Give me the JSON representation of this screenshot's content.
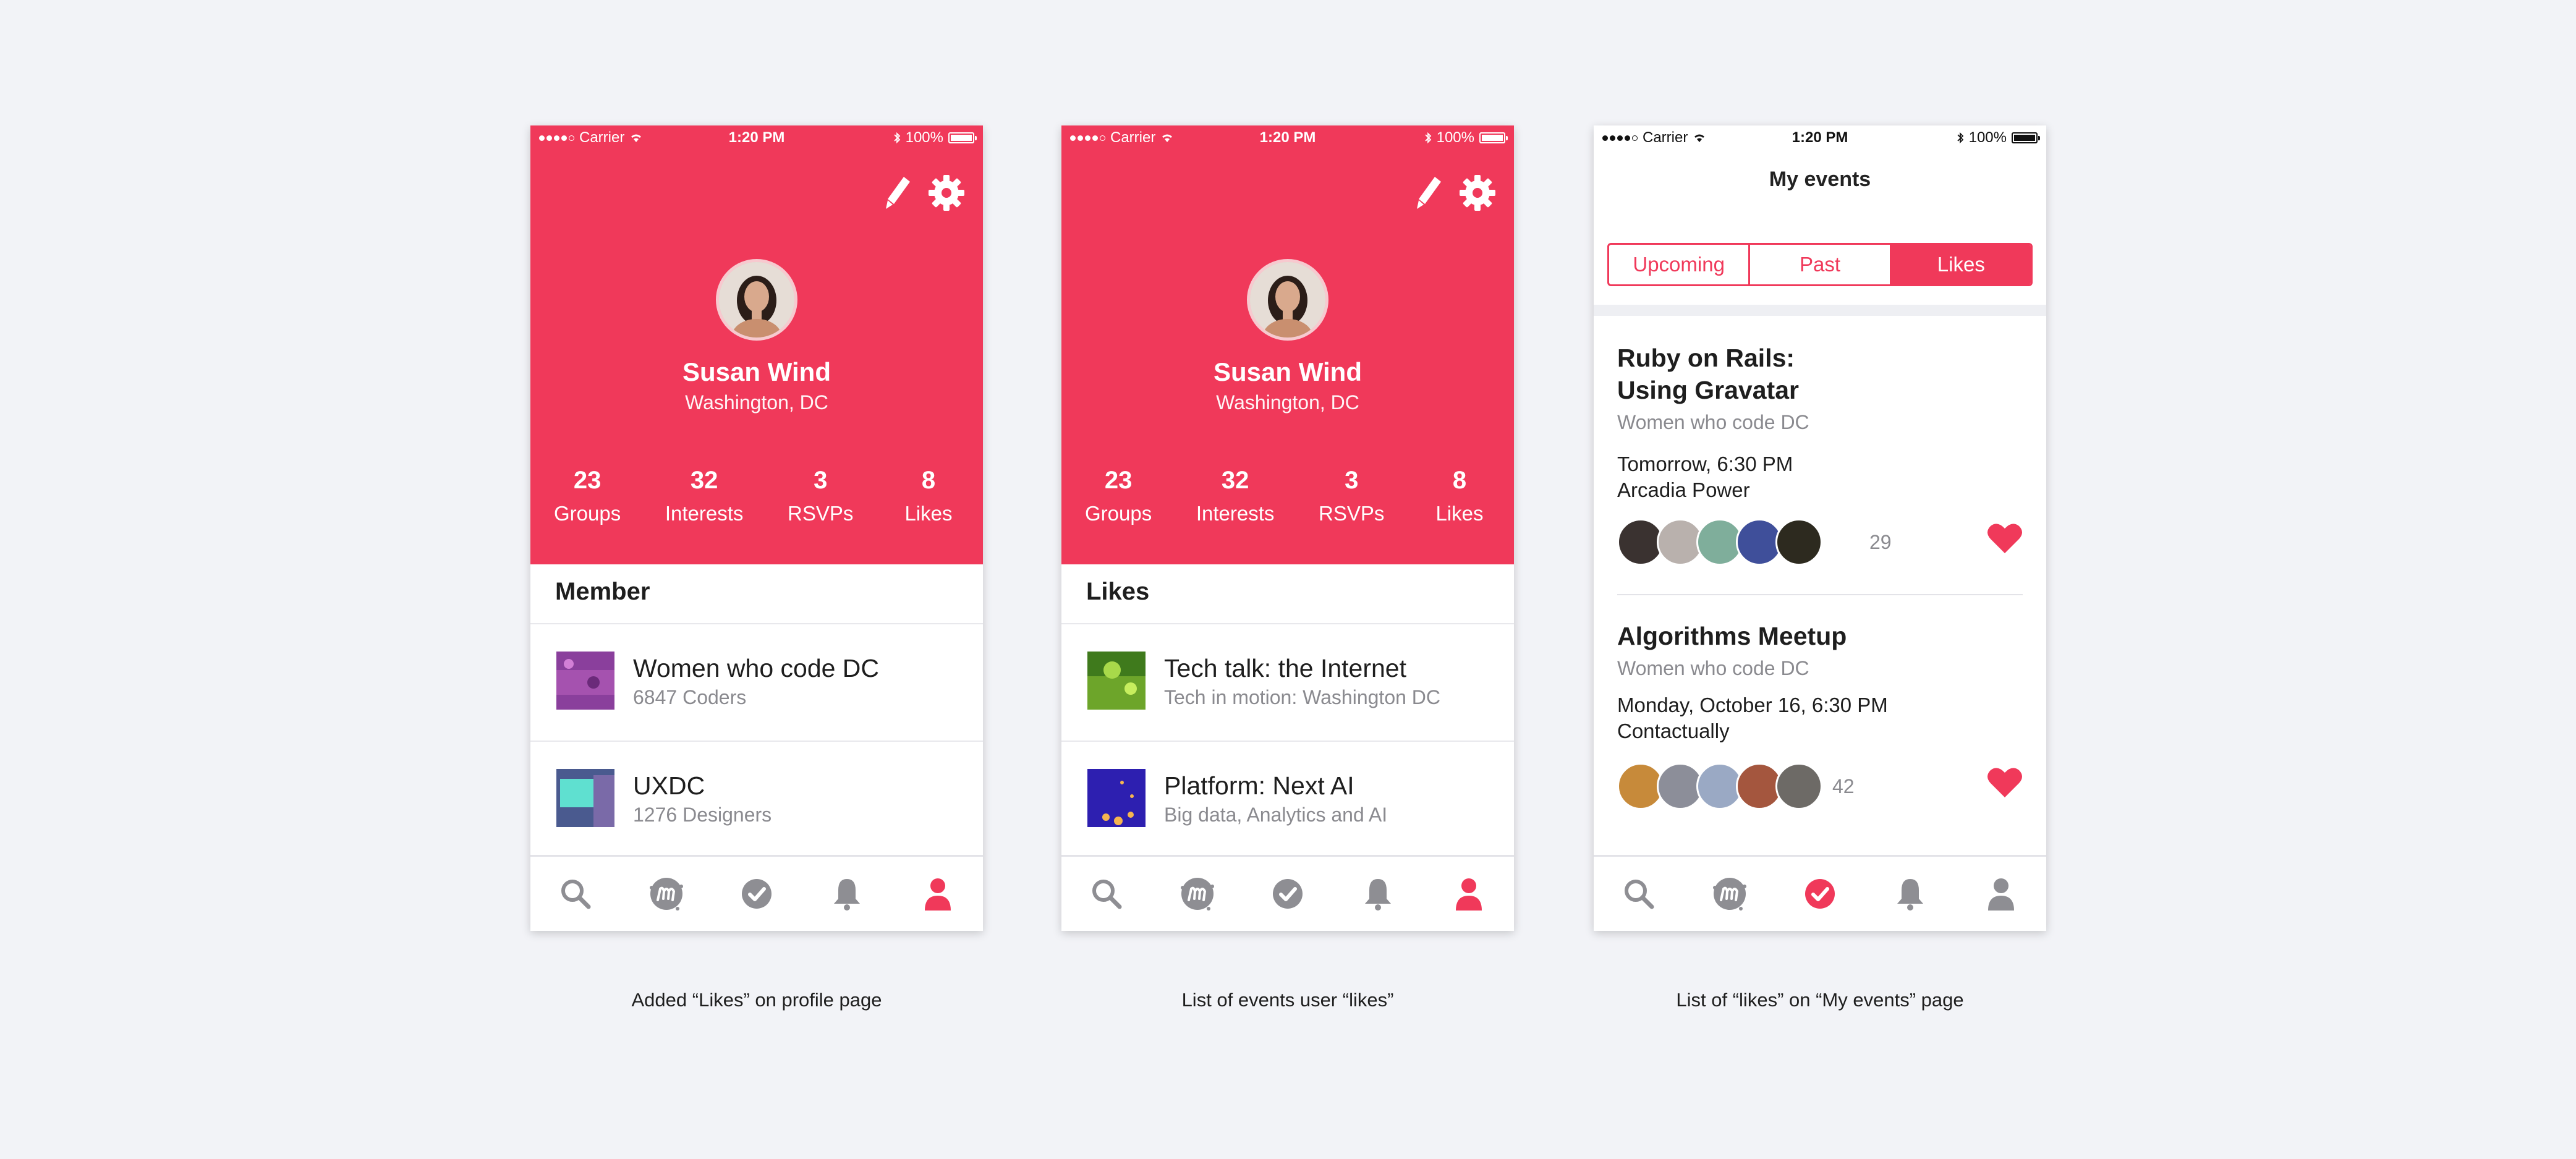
{
  "colors": {
    "accent": "#f0395a",
    "icon_gray": "#8e8e93",
    "background": "#f2f3f7"
  },
  "status_bar": {
    "carrier": "Carrier",
    "time": "1:20 PM",
    "battery": "100%"
  },
  "profile": {
    "name": "Susan Wind",
    "location": "Washington, DC",
    "stats": [
      {
        "value": "23",
        "label": "Groups"
      },
      {
        "value": "32",
        "label": "Interests"
      },
      {
        "value": "3",
        "label": "RSVPs"
      },
      {
        "value": "8",
        "label": "Likes"
      }
    ]
  },
  "screen1": {
    "section_title": "Member",
    "items": [
      {
        "title": "Women who code DC",
        "subtitle": "6847 Coders"
      },
      {
        "title": "UXDC",
        "subtitle": "1276 Designers"
      }
    ]
  },
  "screen2": {
    "section_title": "Likes",
    "items": [
      {
        "title": "Tech talk: the Internet",
        "subtitle": "Tech in motion: Washington DC"
      },
      {
        "title": "Platform: Next AI",
        "subtitle": "Big data, Analytics and AI"
      }
    ]
  },
  "screen3": {
    "title": "My events",
    "tabs": [
      "Upcoming",
      "Past",
      "Likes"
    ],
    "active_tab": "Likes",
    "events": [
      {
        "title_line1": "Ruby on Rails:",
        "title_line2": "Using Gravatar",
        "group": "Women who code DC",
        "time": "Tomorrow, 6:30 PM",
        "venue": "Arcadia Power",
        "attendee_count": "29"
      },
      {
        "title_line1": "Algorithms Meetup",
        "group": "Women who code DC",
        "time": "Monday, October 16,  6:30 PM",
        "venue": "Contactually",
        "attendee_count": "42"
      }
    ]
  },
  "tabbar_icons": [
    "search-icon",
    "meetup-icon",
    "check-icon",
    "bell-icon",
    "profile-icon"
  ],
  "captions": [
    "Added “Likes” on profile page",
    "List of events user “likes”",
    "List of “likes” on “My events” page"
  ]
}
